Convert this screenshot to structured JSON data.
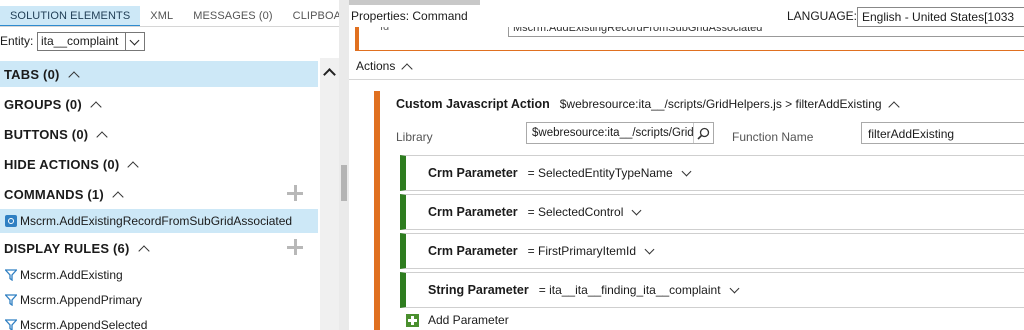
{
  "left_panel": {
    "tabs": [
      "SOLUTION ELEMENTS",
      "XML",
      "MESSAGES (0)",
      "CLIPBOA"
    ],
    "entity_label": "Entity:",
    "entity_value": "ita__complaint",
    "sections": {
      "tabs": "TABS (0)",
      "groups": "GROUPS (0)",
      "buttons": "BUTTONS (0)",
      "hide_actions": "HIDE ACTIONS (0)",
      "commands": "COMMANDS (1)",
      "display_rules": "DISPLAY RULES (6)"
    },
    "command_items": [
      "Mscrm.AddExistingRecordFromSubGridAssociated"
    ],
    "display_rule_items": [
      "Mscrm.AddExisting",
      "Mscrm.AppendPrimary",
      "Mscrm.AppendSelected"
    ]
  },
  "right_panel": {
    "properties_title": "Properties: Command",
    "language_label": "LANGUAGE:",
    "language_value": "English - United States[1033",
    "id_label": "Id",
    "id_value": "Mscrm.AddExistingRecordFromSubGridAssociated",
    "actions_label": "Actions",
    "custom_action": {
      "title": "Custom Javascript Action",
      "summary": "$webresource:ita__/scripts/GridHelpers.js > filterAddExisting",
      "library_label": "Library",
      "library_value": "$webresource:ita__/scripts/GridHelpers.js",
      "function_label": "Function Name",
      "function_value": "filterAddExisting"
    },
    "parameters": [
      {
        "type": "Crm Parameter",
        "value": "= SelectedEntityTypeName"
      },
      {
        "type": "Crm Parameter",
        "value": "= SelectedControl"
      },
      {
        "type": "Crm Parameter",
        "value": "= FirstPrimaryItemId"
      },
      {
        "type": "String Parameter",
        "value": "= ita__ita__finding_ita__complaint"
      }
    ],
    "add_parameter_label": "Add Parameter"
  },
  "colors": {
    "selection": "#cde8f7",
    "action_accent": "#e07020",
    "parameter_accent": "#2e7d1f"
  }
}
